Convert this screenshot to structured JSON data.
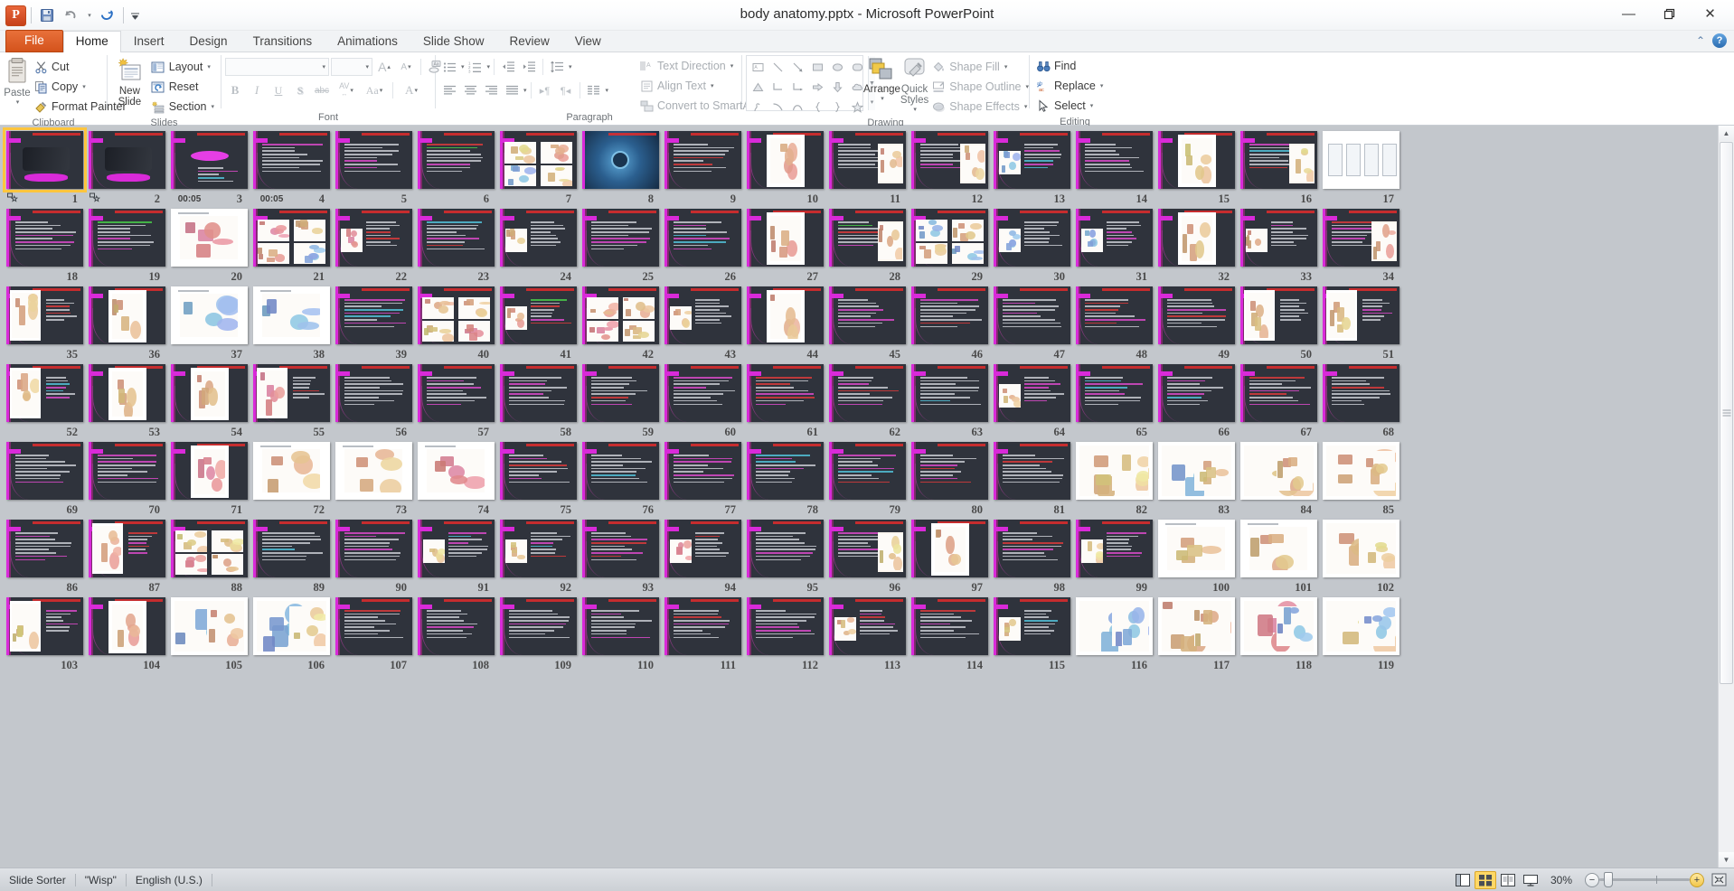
{
  "window": {
    "title": "body anatomy.pptx  -  Microsoft PowerPoint",
    "minimize_label": "—",
    "restore_label": "❐",
    "close_label": "✕"
  },
  "quick_access": {
    "app_letter": "P",
    "items": [
      {
        "name": "save-button",
        "glyph": "💾"
      },
      {
        "name": "undo-button",
        "glyph": "↶"
      },
      {
        "name": "undo-dropdown",
        "glyph": "▾"
      },
      {
        "name": "repeat-button",
        "glyph": "↻"
      },
      {
        "name": "customize-qat-button",
        "glyph": "▾"
      }
    ]
  },
  "tabs": [
    {
      "label": "File",
      "id": "file"
    },
    {
      "label": "Home",
      "id": "home"
    },
    {
      "label": "Insert",
      "id": "insert"
    },
    {
      "label": "Design",
      "id": "design"
    },
    {
      "label": "Transitions",
      "id": "transitions"
    },
    {
      "label": "Animations",
      "id": "animations"
    },
    {
      "label": "Slide Show",
      "id": "slideshow"
    },
    {
      "label": "Review",
      "id": "review"
    },
    {
      "label": "View",
      "id": "view"
    }
  ],
  "tab_right": {
    "minimize_ribbon": "⌃",
    "help": "?"
  },
  "ribbon": {
    "groups": [
      {
        "label": "Clipboard"
      },
      {
        "label": "Slides"
      },
      {
        "label": "Font"
      },
      {
        "label": "Paragraph"
      },
      {
        "label": "Drawing"
      },
      {
        "label": "Editing"
      }
    ],
    "clipboard": {
      "paste_label": "Paste",
      "cut_label": "Cut",
      "copy_label": "Copy",
      "format_painter_label": "Format Painter"
    },
    "slides": {
      "new_slide_label": "New Slide",
      "layout_label": "Layout",
      "reset_label": "Reset",
      "section_label": "Section"
    },
    "font": {
      "font_name_value": "",
      "font_size_value": "",
      "grow_font": "A",
      "shrink_font": "A",
      "clear_formatting": "Aa",
      "bold": "B",
      "italic": "I",
      "underline": "U",
      "shadow": "S",
      "strikethrough": "abc",
      "character_spacing": "AV",
      "change_case": "Aa",
      "font_color": "A"
    },
    "paragraph": {
      "text_direction_label": "Text Direction",
      "align_text_label": "Align Text",
      "convert_smartart_label": "Convert to SmartArt"
    },
    "drawing": {
      "arrange_label": "Arrange",
      "quick_styles_label": "Quick Styles",
      "shape_fill_label": "Shape Fill",
      "shape_outline_label": "Shape Outline",
      "shape_effects_label": "Shape Effects"
    },
    "editing": {
      "find_label": "Find",
      "replace_label": "Replace",
      "select_label": "Select"
    }
  },
  "status_bar": {
    "view_name": "Slide Sorter",
    "theme_name": "\"Wisp\"",
    "language": "English (U.S.)",
    "zoom_level": "30%",
    "view_buttons": [
      {
        "name": "normal-view-button",
        "active": false
      },
      {
        "name": "slide-sorter-view-button",
        "active": true
      },
      {
        "name": "reading-view-button",
        "active": false
      },
      {
        "name": "slide-show-button",
        "active": false
      }
    ],
    "zoom_out_label": "−",
    "zoom_in_label": "+",
    "fit_to_window_label": "fit-slide-to-window"
  },
  "sorter": {
    "selected_slide": 1,
    "columns": 17,
    "slides": [
      {
        "n": 1,
        "transition": true,
        "time": "",
        "style": "title-dark",
        "sel": true
      },
      {
        "n": 2,
        "transition": true,
        "time": "",
        "style": "title-dark"
      },
      {
        "n": 3,
        "transition": false,
        "time": "00:05",
        "style": "banner-dark"
      },
      {
        "n": 4,
        "transition": false,
        "time": "00:05",
        "style": "text-dark"
      },
      {
        "n": 5,
        "transition": false,
        "time": "",
        "style": "text-dark"
      },
      {
        "n": 6,
        "transition": false,
        "time": "",
        "style": "text-dark"
      },
      {
        "n": 7,
        "transition": false,
        "time": "",
        "style": "img-grid"
      },
      {
        "n": 8,
        "transition": false,
        "time": "",
        "style": "img-cell"
      },
      {
        "n": 9,
        "transition": false,
        "time": "",
        "style": "text-dark"
      },
      {
        "n": 10,
        "transition": false,
        "time": "",
        "style": "img-body-white"
      },
      {
        "n": 11,
        "transition": false,
        "time": "",
        "style": "img-right"
      },
      {
        "n": 12,
        "transition": false,
        "time": "",
        "style": "img-right"
      },
      {
        "n": 13,
        "transition": false,
        "time": "",
        "style": "img-small"
      },
      {
        "n": 14,
        "transition": false,
        "time": "",
        "style": "text-dark"
      },
      {
        "n": 15,
        "transition": false,
        "time": "",
        "style": "img-body-white"
      },
      {
        "n": 16,
        "transition": false,
        "time": "",
        "style": "img-right"
      },
      {
        "n": 17,
        "transition": false,
        "time": "",
        "style": "img-white-chart"
      },
      {
        "n": 18,
        "transition": false,
        "time": "",
        "style": "text-dark"
      },
      {
        "n": 19,
        "transition": false,
        "time": "",
        "style": "text-dark"
      },
      {
        "n": 20,
        "transition": false,
        "time": "",
        "style": "white-diagram"
      },
      {
        "n": 21,
        "transition": false,
        "time": "",
        "style": "img-grid"
      },
      {
        "n": 22,
        "transition": false,
        "time": "",
        "style": "img-small"
      },
      {
        "n": 23,
        "transition": false,
        "time": "",
        "style": "text-dark"
      },
      {
        "n": 24,
        "transition": false,
        "time": "",
        "style": "img-small"
      },
      {
        "n": 25,
        "transition": false,
        "time": "",
        "style": "text-dark"
      },
      {
        "n": 26,
        "transition": false,
        "time": "",
        "style": "text-dark"
      },
      {
        "n": 27,
        "transition": false,
        "time": "",
        "style": "img-body-white"
      },
      {
        "n": 28,
        "transition": false,
        "time": "",
        "style": "img-right"
      },
      {
        "n": 29,
        "transition": false,
        "time": "",
        "style": "img-grid"
      },
      {
        "n": 30,
        "transition": false,
        "time": "",
        "style": "img-small"
      },
      {
        "n": 31,
        "transition": false,
        "time": "",
        "style": "img-small"
      },
      {
        "n": 32,
        "transition": false,
        "time": "",
        "style": "img-body-white"
      },
      {
        "n": 33,
        "transition": false,
        "time": "",
        "style": "img-small"
      },
      {
        "n": 34,
        "transition": false,
        "time": "",
        "style": "img-right"
      },
      {
        "n": 35,
        "transition": false,
        "time": "",
        "style": "img-left-white"
      },
      {
        "n": 36,
        "transition": false,
        "time": "",
        "style": "img-body-white"
      },
      {
        "n": 37,
        "transition": false,
        "time": "",
        "style": "white-diagram"
      },
      {
        "n": 38,
        "transition": false,
        "time": "",
        "style": "white-diagram"
      },
      {
        "n": 39,
        "transition": false,
        "time": "",
        "style": "text-dark"
      },
      {
        "n": 40,
        "transition": false,
        "time": "",
        "style": "img-grid"
      },
      {
        "n": 41,
        "transition": false,
        "time": "",
        "style": "img-small"
      },
      {
        "n": 42,
        "transition": false,
        "time": "",
        "style": "img-grid"
      },
      {
        "n": 43,
        "transition": false,
        "time": "",
        "style": "img-small"
      },
      {
        "n": 44,
        "transition": false,
        "time": "",
        "style": "img-body-white"
      },
      {
        "n": 45,
        "transition": false,
        "time": "",
        "style": "text-dark"
      },
      {
        "n": 46,
        "transition": false,
        "time": "",
        "style": "text-dark"
      },
      {
        "n": 47,
        "transition": false,
        "time": "",
        "style": "text-dark"
      },
      {
        "n": 48,
        "transition": false,
        "time": "",
        "style": "text-dark"
      },
      {
        "n": 49,
        "transition": false,
        "time": "",
        "style": "text-dark"
      },
      {
        "n": 50,
        "transition": false,
        "time": "",
        "style": "img-left-white"
      },
      {
        "n": 51,
        "transition": false,
        "time": "",
        "style": "img-left-white"
      },
      {
        "n": 52,
        "transition": false,
        "time": "",
        "style": "img-left-white"
      },
      {
        "n": 53,
        "transition": false,
        "time": "",
        "style": "img-body-white"
      },
      {
        "n": 54,
        "transition": false,
        "time": "",
        "style": "img-body-white"
      },
      {
        "n": 55,
        "transition": false,
        "time": "",
        "style": "img-left-white"
      },
      {
        "n": 56,
        "transition": false,
        "time": "",
        "style": "text-dark"
      },
      {
        "n": 57,
        "transition": false,
        "time": "",
        "style": "text-dark"
      },
      {
        "n": 58,
        "transition": false,
        "time": "",
        "style": "text-dark"
      },
      {
        "n": 59,
        "transition": false,
        "time": "",
        "style": "text-dark"
      },
      {
        "n": 60,
        "transition": false,
        "time": "",
        "style": "text-dark"
      },
      {
        "n": 61,
        "transition": false,
        "time": "",
        "style": "text-dark"
      },
      {
        "n": 62,
        "transition": false,
        "time": "",
        "style": "text-dark"
      },
      {
        "n": 63,
        "transition": false,
        "time": "",
        "style": "text-dark"
      },
      {
        "n": 64,
        "transition": false,
        "time": "",
        "style": "img-small"
      },
      {
        "n": 65,
        "transition": false,
        "time": "",
        "style": "text-dark"
      },
      {
        "n": 66,
        "transition": false,
        "time": "",
        "style": "text-dark"
      },
      {
        "n": 67,
        "transition": false,
        "time": "",
        "style": "text-dark"
      },
      {
        "n": 68,
        "transition": false,
        "time": "",
        "style": "text-dark"
      },
      {
        "n": 69,
        "transition": false,
        "time": "",
        "style": "text-dark"
      },
      {
        "n": 70,
        "transition": false,
        "time": "",
        "style": "text-dark"
      },
      {
        "n": 71,
        "transition": false,
        "time": "",
        "style": "img-body-white"
      },
      {
        "n": 72,
        "transition": false,
        "time": "",
        "style": "white-diagram"
      },
      {
        "n": 73,
        "transition": false,
        "time": "",
        "style": "white-diagram"
      },
      {
        "n": 74,
        "transition": false,
        "time": "",
        "style": "white-diagram"
      },
      {
        "n": 75,
        "transition": false,
        "time": "",
        "style": "text-dark"
      },
      {
        "n": 76,
        "transition": false,
        "time": "",
        "style": "text-dark"
      },
      {
        "n": 77,
        "transition": false,
        "time": "",
        "style": "text-dark"
      },
      {
        "n": 78,
        "transition": false,
        "time": "",
        "style": "text-dark"
      },
      {
        "n": 79,
        "transition": false,
        "time": "",
        "style": "text-dark"
      },
      {
        "n": 80,
        "transition": false,
        "time": "",
        "style": "text-dark"
      },
      {
        "n": 81,
        "transition": false,
        "time": "",
        "style": "text-dark"
      },
      {
        "n": 82,
        "transition": false,
        "time": "",
        "style": "img-full-color"
      },
      {
        "n": 83,
        "transition": false,
        "time": "",
        "style": "img-full-color"
      },
      {
        "n": 84,
        "transition": false,
        "time": "",
        "style": "img-full-color"
      },
      {
        "n": 85,
        "transition": false,
        "time": "",
        "style": "img-full-color"
      },
      {
        "n": 86,
        "transition": false,
        "time": "",
        "style": "text-dark"
      },
      {
        "n": 87,
        "transition": false,
        "time": "",
        "style": "img-left-white"
      },
      {
        "n": 88,
        "transition": false,
        "time": "",
        "style": "img-grid"
      },
      {
        "n": 89,
        "transition": false,
        "time": "",
        "style": "text-dark"
      },
      {
        "n": 90,
        "transition": false,
        "time": "",
        "style": "text-dark"
      },
      {
        "n": 91,
        "transition": false,
        "time": "",
        "style": "img-small"
      },
      {
        "n": 92,
        "transition": false,
        "time": "",
        "style": "img-small"
      },
      {
        "n": 93,
        "transition": false,
        "time": "",
        "style": "text-dark"
      },
      {
        "n": 94,
        "transition": false,
        "time": "",
        "style": "img-small"
      },
      {
        "n": 95,
        "transition": false,
        "time": "",
        "style": "text-dark"
      },
      {
        "n": 96,
        "transition": false,
        "time": "",
        "style": "img-right"
      },
      {
        "n": 97,
        "transition": false,
        "time": "",
        "style": "img-body-white"
      },
      {
        "n": 98,
        "transition": false,
        "time": "",
        "style": "text-dark"
      },
      {
        "n": 99,
        "transition": false,
        "time": "",
        "style": "img-small"
      },
      {
        "n": 100,
        "transition": false,
        "time": "",
        "style": "white-diagram"
      },
      {
        "n": 101,
        "transition": false,
        "time": "",
        "style": "white-diagram"
      },
      {
        "n": 102,
        "transition": false,
        "time": "",
        "style": "img-full-color"
      },
      {
        "n": 103,
        "transition": false,
        "time": "",
        "style": "img-left-white"
      },
      {
        "n": 104,
        "transition": false,
        "time": "",
        "style": "img-body-white"
      },
      {
        "n": 105,
        "transition": false,
        "time": "",
        "style": "img-full-color"
      },
      {
        "n": 106,
        "transition": false,
        "time": "",
        "style": "img-full-color"
      },
      {
        "n": 107,
        "transition": false,
        "time": "",
        "style": "text-dark"
      },
      {
        "n": 108,
        "transition": false,
        "time": "",
        "style": "text-dark"
      },
      {
        "n": 109,
        "transition": false,
        "time": "",
        "style": "text-dark"
      },
      {
        "n": 110,
        "transition": false,
        "time": "",
        "style": "text-dark"
      },
      {
        "n": 111,
        "transition": false,
        "time": "",
        "style": "text-dark"
      },
      {
        "n": 112,
        "transition": false,
        "time": "",
        "style": "text-dark"
      },
      {
        "n": 113,
        "transition": false,
        "time": "",
        "style": "img-small"
      },
      {
        "n": 114,
        "transition": false,
        "time": "",
        "style": "text-dark"
      },
      {
        "n": 115,
        "transition": false,
        "time": "",
        "style": "img-small"
      },
      {
        "n": 116,
        "transition": false,
        "time": "",
        "style": "img-full-color"
      },
      {
        "n": 117,
        "transition": false,
        "time": "",
        "style": "img-full-color"
      },
      {
        "n": 118,
        "transition": false,
        "time": "",
        "style": "img-full-color"
      },
      {
        "n": 119,
        "transition": false,
        "time": "",
        "style": "img-full-color"
      }
    ]
  }
}
